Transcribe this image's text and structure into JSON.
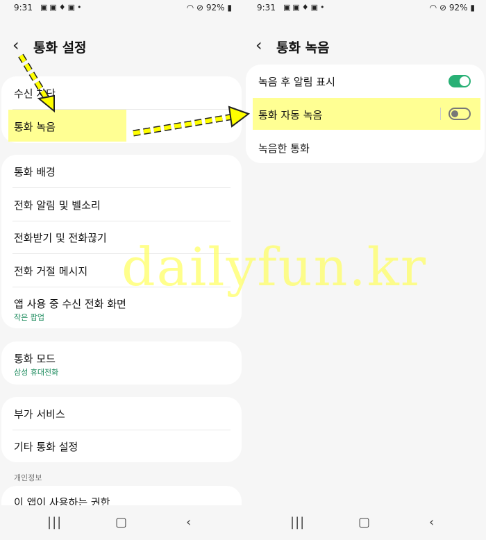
{
  "status_bar": {
    "time": "9:31",
    "battery": "92%"
  },
  "left": {
    "title": "통화 설정",
    "group1": [
      "수신 차단",
      "통화 녹음"
    ],
    "group2": [
      {
        "label": "통화 배경"
      },
      {
        "label": "전화 알림 및 벨소리"
      },
      {
        "label": "전화받기 및 전화끊기"
      },
      {
        "label": "전화 거절 메시지"
      },
      {
        "label": "앱 사용 중 수신 전화 화면",
        "sub": "작은 팝업"
      }
    ],
    "group3": {
      "label": "통화 모드",
      "sub": "삼성 휴대전화"
    },
    "group4": [
      "부가 서비스",
      "기타 통화 설정"
    ],
    "section_header": "개인정보",
    "group5": [
      "이 앱이 사용하는 권한"
    ]
  },
  "right": {
    "title": "통화 녹음",
    "items": [
      {
        "label": "녹음 후 알림 표시",
        "toggle": true
      },
      {
        "label": "통화 자동 녹음",
        "toggle": false
      },
      {
        "label": "녹음한 통화"
      }
    ]
  },
  "watermark": "dailyfun.kr",
  "colors": {
    "accent": "#28b075",
    "highlight": "#ffff80",
    "arrow": "#ffff00",
    "subtext": "#1b8a5c"
  },
  "icons": {
    "back": "chevron-left-icon",
    "nav_recents": "recents-icon",
    "nav_home": "home-icon",
    "nav_back": "back-icon"
  }
}
